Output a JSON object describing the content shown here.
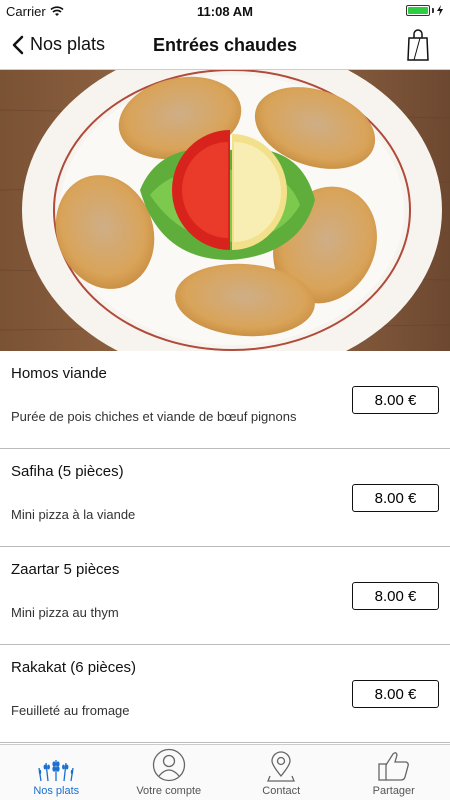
{
  "status": {
    "carrier": "Carrier",
    "time": "11:08 AM"
  },
  "nav": {
    "back_label": "Nos plats",
    "title": "Entrées chaudes"
  },
  "dishes": [
    {
      "name": "Homos viande",
      "desc": "Purée de pois chiches et viande de bœuf pignons",
      "price": "8.00 €"
    },
    {
      "name": "Safiha (5 pièces)",
      "desc": "Mini pizza à la viande",
      "price": "8.00 €"
    },
    {
      "name": "Zaartar 5 pièces",
      "desc": "Mini pizza au thym",
      "price": "8.00 €"
    },
    {
      "name": "Rakakat (6 pièces)",
      "desc": "Feuilleté au fromage",
      "price": "8.00 €"
    }
  ],
  "tabs": [
    {
      "label": "Nos plats",
      "icon": "wheat-icon",
      "active": true
    },
    {
      "label": "Votre compte",
      "icon": "user-icon",
      "active": false
    },
    {
      "label": "Contact",
      "icon": "location-pin-icon",
      "active": false
    },
    {
      "label": "Partager",
      "icon": "thumbs-up-icon",
      "active": false
    }
  ],
  "colors": {
    "accent": "#1a6fd1",
    "battery": "#2ecc40"
  }
}
